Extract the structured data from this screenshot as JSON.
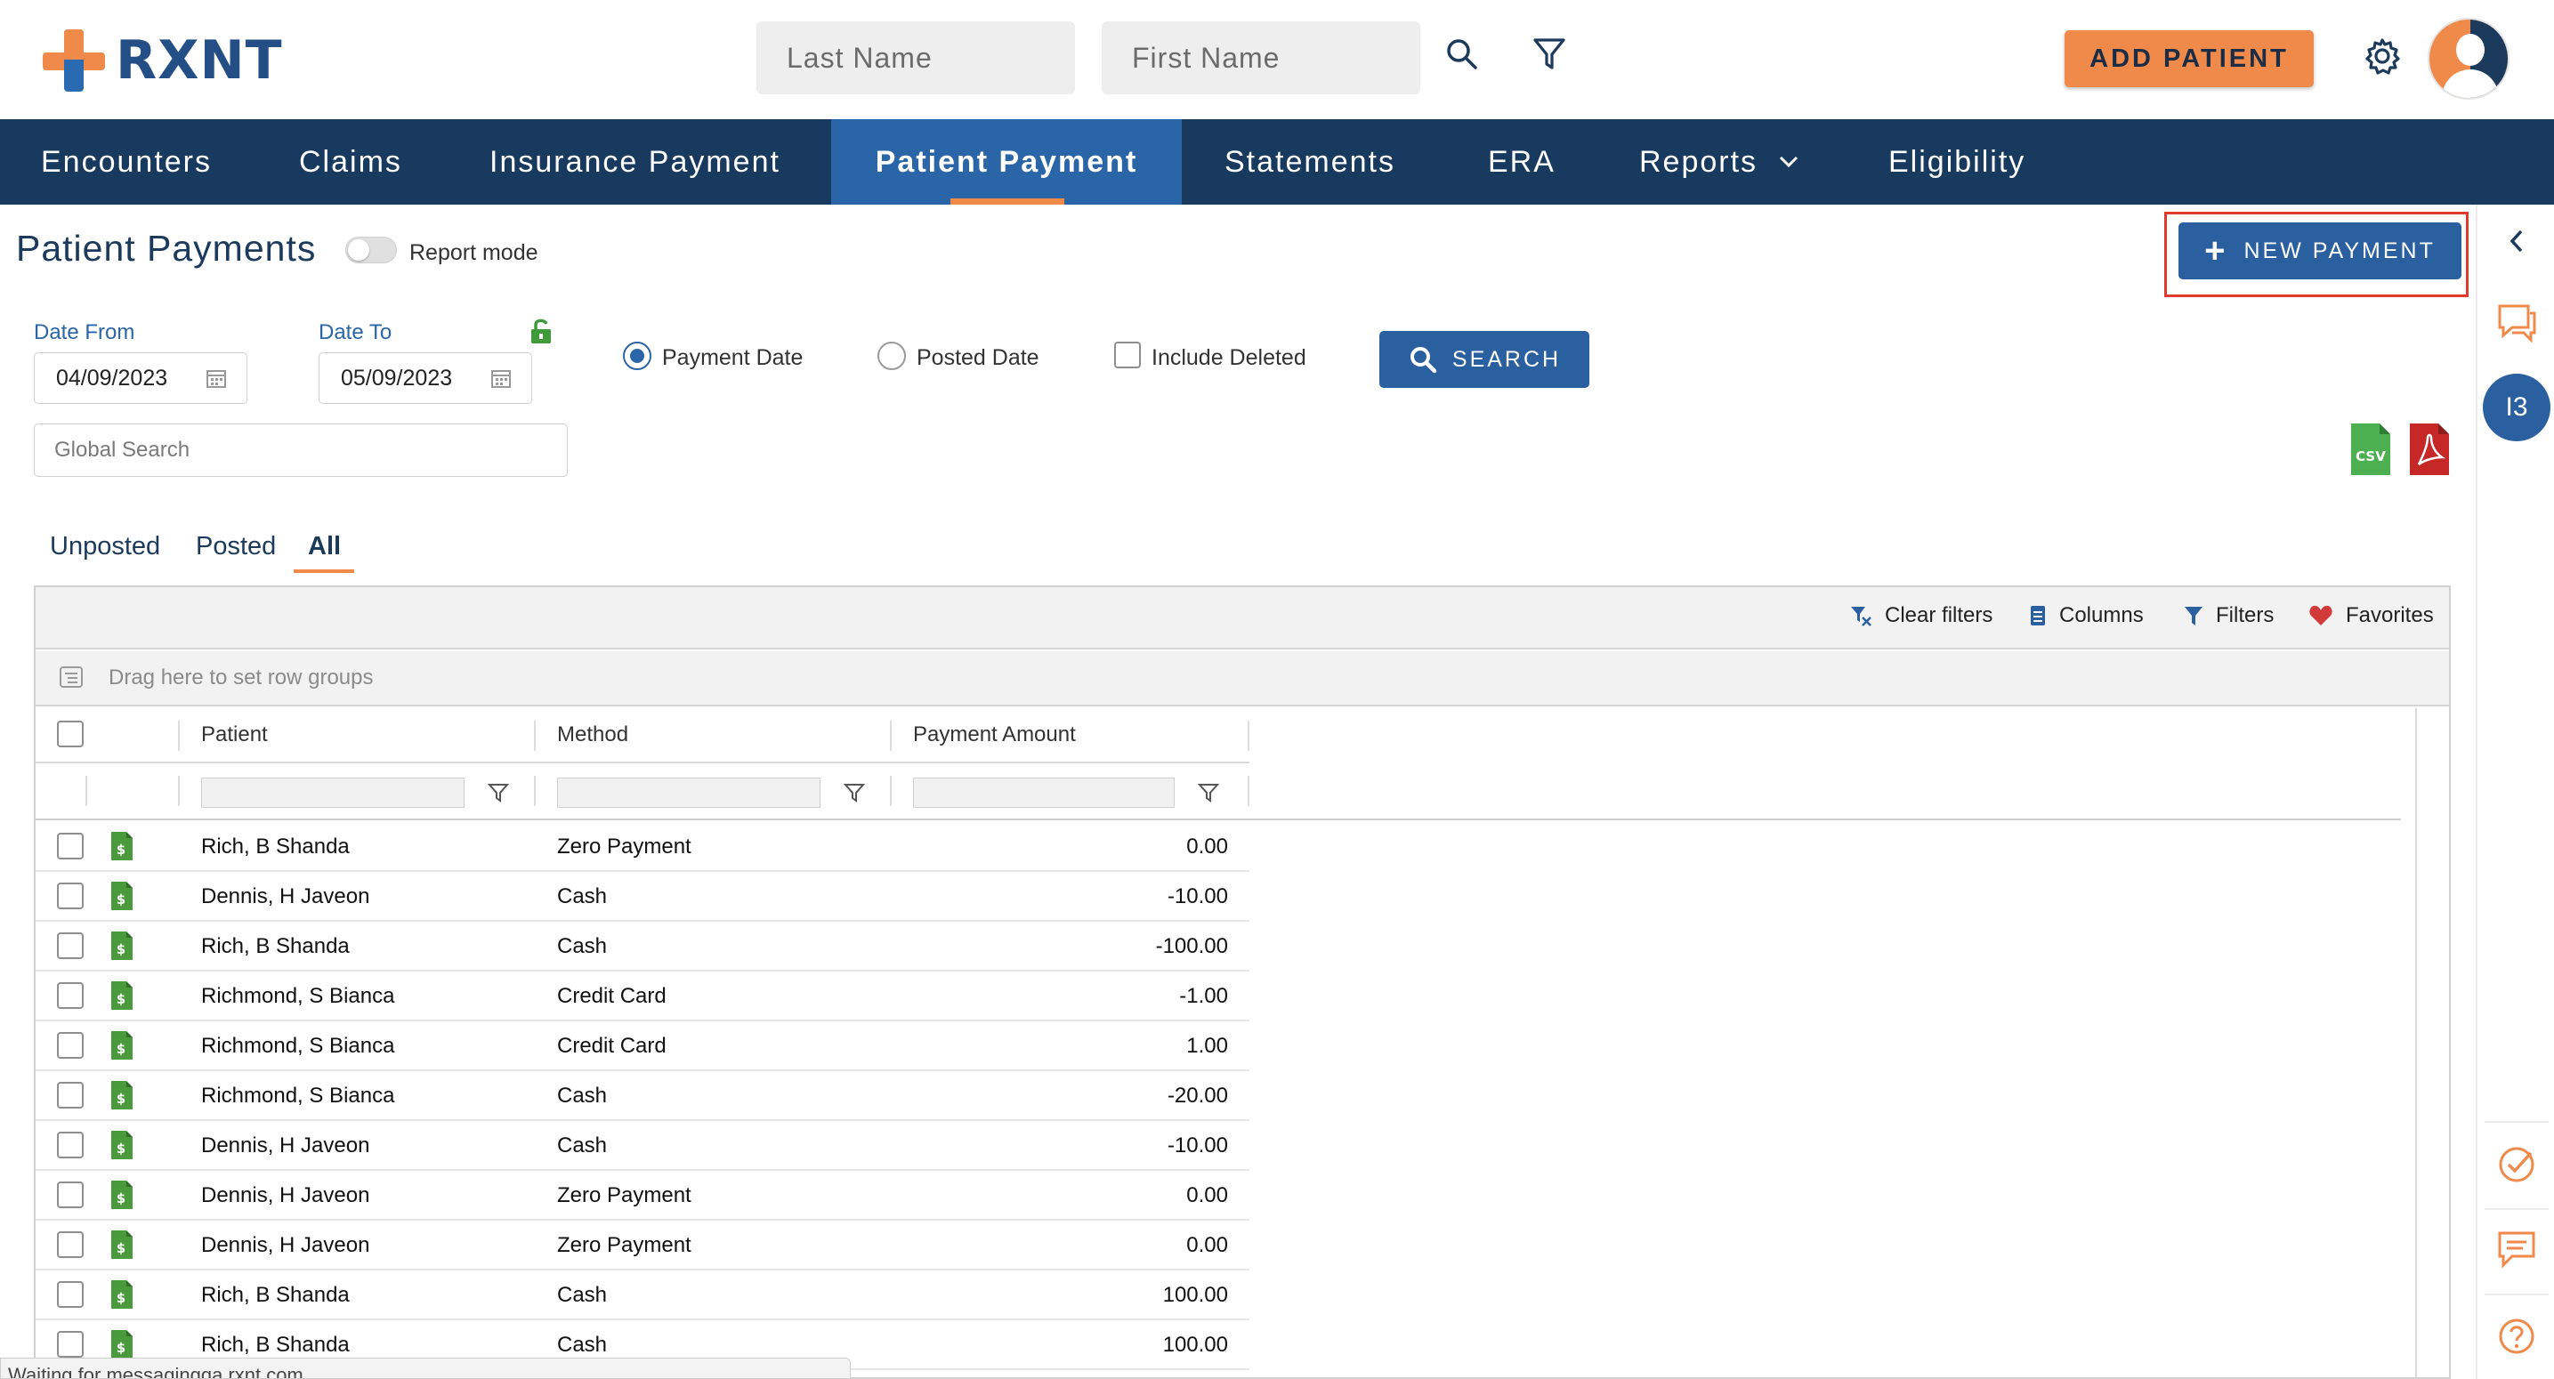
{
  "brand": {
    "name": "RXNT",
    "colors": {
      "navy": "#173a5e",
      "active_blue": "#2a65a8",
      "orange": "#f08a4b",
      "button_blue": "#2a5fa0",
      "highlight_red": "#e03a2e"
    }
  },
  "header": {
    "last_name_placeholder": "Last Name",
    "first_name_placeholder": "First Name",
    "add_patient_label": "ADD PATIENT",
    "icons": [
      "search-icon",
      "filter-icon",
      "gear-icon",
      "avatar"
    ]
  },
  "nav": {
    "items": [
      {
        "label": "Encounters"
      },
      {
        "label": "Claims"
      },
      {
        "label": "Insurance Payment"
      },
      {
        "label": "Patient Payment",
        "active": true
      },
      {
        "label": "Statements"
      },
      {
        "label": "ERA"
      },
      {
        "label": "Reports",
        "dropdown": true
      },
      {
        "label": "Eligibility"
      }
    ]
  },
  "page": {
    "title": "Patient Payments",
    "report_mode_label": "Report mode",
    "report_mode_on": false,
    "new_payment_label": "NEW PAYMENT"
  },
  "filters": {
    "date_from_label": "Date From",
    "date_from_value": "04/09/2023",
    "date_to_label": "Date To",
    "date_to_value": "05/09/2023",
    "payment_date_label": "Payment Date",
    "posted_date_label": "Posted Date",
    "include_deleted_label": "Include Deleted",
    "selected_date_type": "Payment Date",
    "search_label": "SEARCH",
    "global_search_placeholder": "Global Search",
    "export_icons": {
      "csv": "CSV",
      "pdf": "pdf-icon"
    }
  },
  "tabs": {
    "items": [
      {
        "label": "Unposted"
      },
      {
        "label": "Posted"
      },
      {
        "label": "All",
        "active": true
      }
    ]
  },
  "grid": {
    "toolbar": {
      "clear_filters": "Clear filters",
      "columns": "Columns",
      "filters": "Filters",
      "favorites": "Favorites"
    },
    "group_hint": "Drag here to set row groups",
    "columns": [
      "Patient",
      "Method",
      "Payment Amount"
    ],
    "rows": [
      {
        "patient": "Rich, B Shanda",
        "method": "Zero Payment",
        "amount": "0.00"
      },
      {
        "patient": "Dennis, H Javeon",
        "method": "Cash",
        "amount": "-10.00"
      },
      {
        "patient": "Rich, B Shanda",
        "method": "Cash",
        "amount": "-100.00"
      },
      {
        "patient": "Richmond, S Bianca",
        "method": "Credit Card",
        "amount": "-1.00"
      },
      {
        "patient": "Richmond, S Bianca",
        "method": "Credit Card",
        "amount": "1.00"
      },
      {
        "patient": "Richmond, S Bianca",
        "method": "Cash",
        "amount": "-20.00"
      },
      {
        "patient": "Dennis, H Javeon",
        "method": "Cash",
        "amount": "-10.00"
      },
      {
        "patient": "Dennis, H Javeon",
        "method": "Zero Payment",
        "amount": "0.00"
      },
      {
        "patient": "Dennis, H Javeon",
        "method": "Zero Payment",
        "amount": "0.00"
      },
      {
        "patient": "Rich, B Shanda",
        "method": "Cash",
        "amount": "100.00"
      },
      {
        "patient": "Rich, B Shanda",
        "method": "Cash",
        "amount": "100.00"
      }
    ]
  },
  "rail": {
    "badge": "I3",
    "icons": [
      "collapse-left-icon",
      "chat-icon",
      "tasks-check-icon",
      "message-icon",
      "help-icon"
    ]
  },
  "status_bar": {
    "text": "Waiting for messagingqa.rxnt.com..."
  }
}
